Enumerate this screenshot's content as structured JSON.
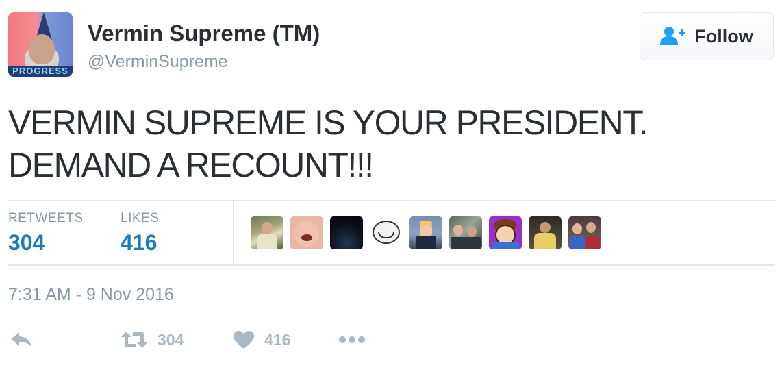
{
  "user": {
    "name": "Vermin Supreme (TM)",
    "handle": "@VerminSupreme",
    "avatar_banner_text": "PROGRESS"
  },
  "follow_button": {
    "label": "Follow",
    "icon": "follow-person-plus-icon"
  },
  "tweet": {
    "lines": [
      "VERMIN SUPREME IS YOUR PRESIDENT.",
      "DEMAND A RECOUNT!!!"
    ]
  },
  "stats": {
    "retweets_label": "RETWEETS",
    "retweets_value": "304",
    "likes_label": "LIKES",
    "likes_value": "416"
  },
  "likers": [
    {
      "name": "liker-avatar-1"
    },
    {
      "name": "liker-avatar-2"
    },
    {
      "name": "liker-avatar-3"
    },
    {
      "name": "liker-avatar-4"
    },
    {
      "name": "liker-avatar-5"
    },
    {
      "name": "liker-avatar-6"
    },
    {
      "name": "liker-avatar-7"
    },
    {
      "name": "liker-avatar-8"
    },
    {
      "name": "liker-avatar-9"
    }
  ],
  "timestamp": "7:31 AM - 9 Nov 2016",
  "actions": {
    "reply_icon": "reply-icon",
    "retweet_icon": "retweet-icon",
    "retweet_count": "304",
    "like_icon": "heart-icon",
    "like_count": "416",
    "more_icon": "more-dots-icon"
  },
  "colors": {
    "accent": "#1b7db8",
    "muted": "#8899a6",
    "action_gray": "#aab8c2",
    "text": "#292f33",
    "border": "#e1e8ed",
    "follow_icon_blue": "#1da1f2"
  }
}
